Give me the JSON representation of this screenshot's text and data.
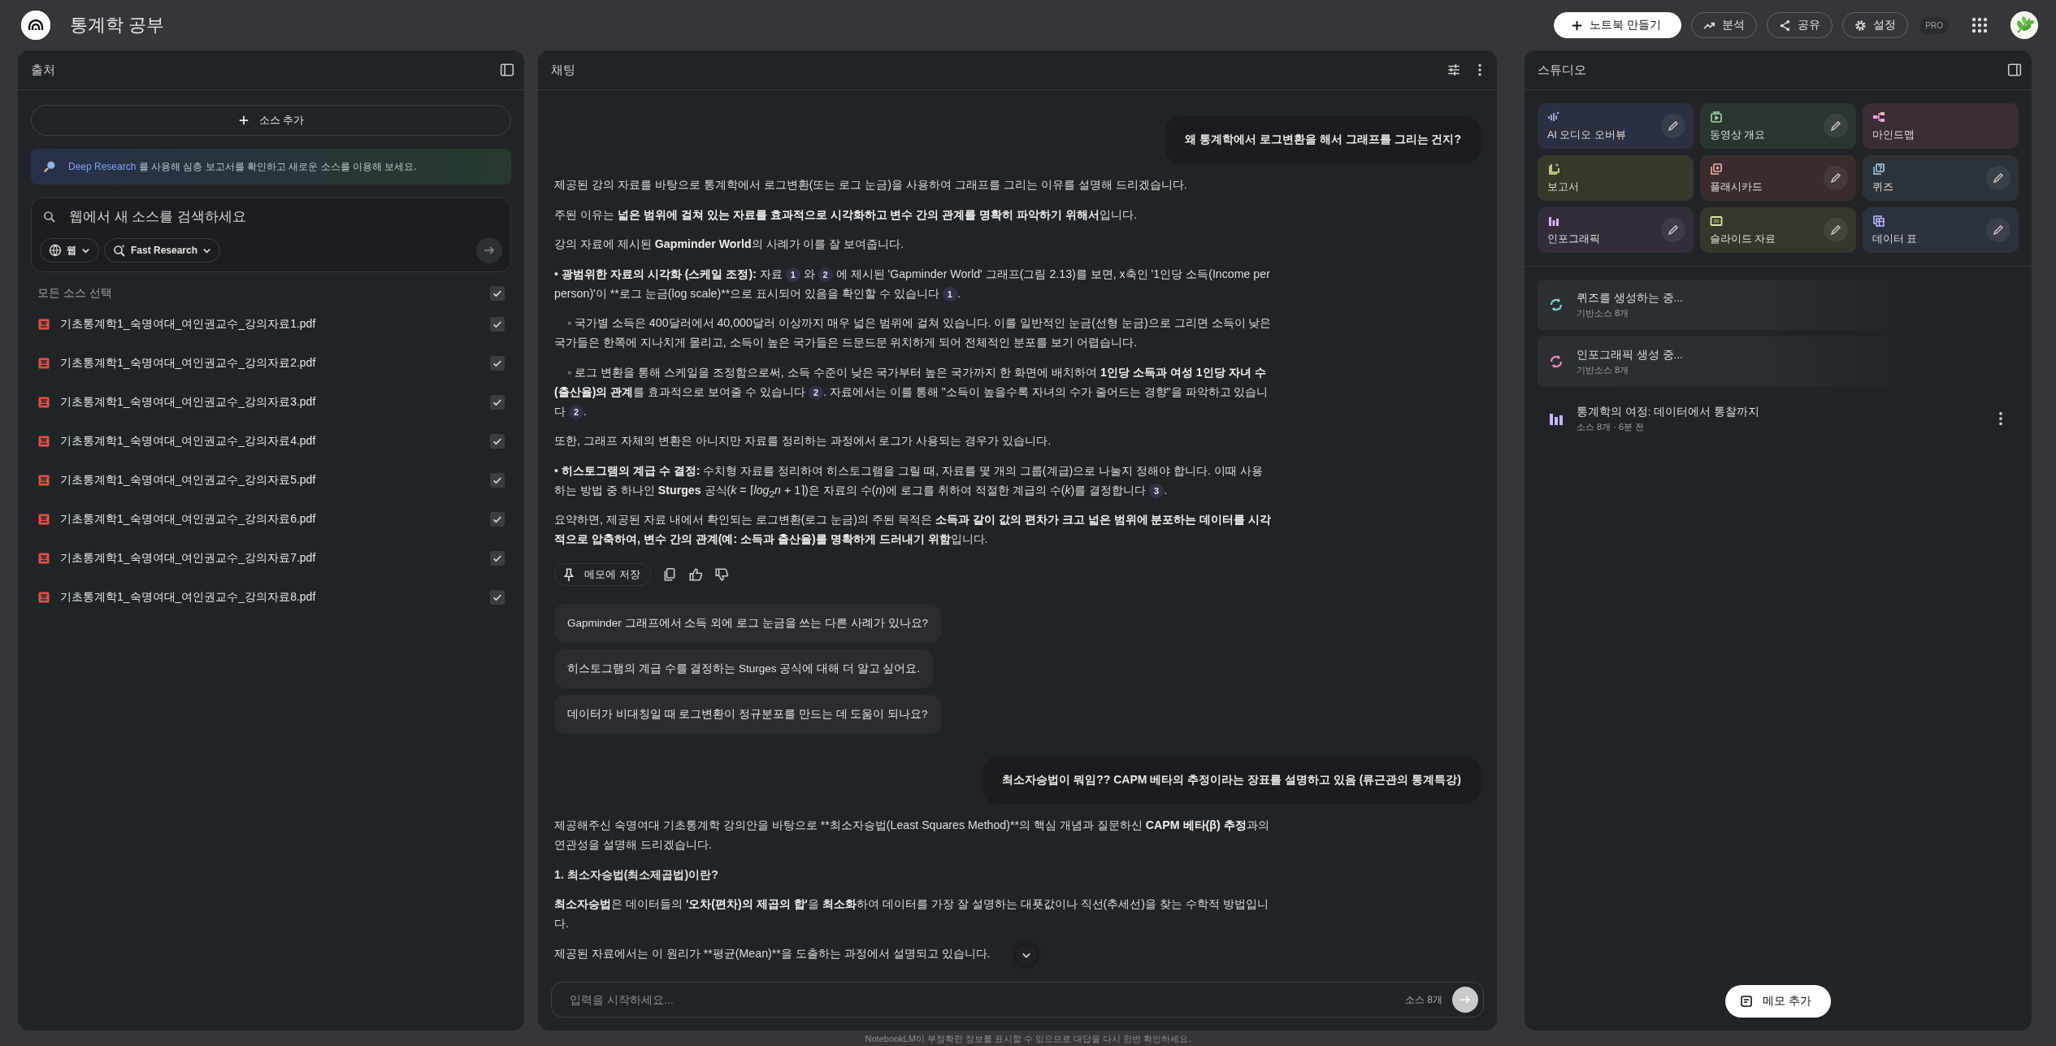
{
  "app": {
    "title": "통계학 공부"
  },
  "header_actions": [
    {
      "kind": "create",
      "label": "노트북 만들기"
    },
    {
      "kind": "analytics",
      "label": "분석"
    },
    {
      "kind": "share",
      "label": "공유"
    },
    {
      "kind": "settings",
      "label": "설정"
    }
  ],
  "plan_badge": "PRO",
  "sources": {
    "title": "출처",
    "add_button": "소스 추가",
    "banner": {
      "link": "Deep Research",
      "text": " 를 사용해 심층 보고서를 확인하고 새로운 소스를 이용해 보세요."
    },
    "search": {
      "placeholder": "웹에서 새 소스를 검색하세요",
      "source_chip": "웹",
      "mode_chip": "Fast Research"
    },
    "select_all": {
      "label": "모든 소스 선택",
      "checked": true
    },
    "items": [
      {
        "name": "기초통계학1_숙명여대_여인권교수_강의자료1.pdf",
        "checked": true
      },
      {
        "name": "기초통계학1_숙명여대_여인권교수_강의자료2.pdf",
        "checked": true
      },
      {
        "name": "기초통계학1_숙명여대_여인권교수_강의자료3.pdf",
        "checked": true
      },
      {
        "name": "기초통계학1_숙명여대_여인권교수_강의자료4.pdf",
        "checked": true
      },
      {
        "name": "기초통계학1_숙명여대_여인권교수_강의자료5.pdf",
        "checked": true
      },
      {
        "name": "기초통계학1_숙명여대_여인권교수_강의자료6.pdf",
        "checked": true
      },
      {
        "name": "기초통계학1_숙명여대_여인권교수_강의자료7.pdf",
        "checked": true
      },
      {
        "name": "기초통계학1_숙명여대_여인권교수_강의자료8.pdf",
        "checked": true
      }
    ]
  },
  "chat": {
    "title": "채팅",
    "messages": [
      {
        "kind": "user",
        "text": "왜 통계학에서 로그변환을 해서 그래프를 그리는 건지?"
      },
      {
        "kind": "answer",
        "save_label": "메모에 저장",
        "blocks": [
          {
            "kind": "p",
            "parts": [
              {
                "md": "제공된 강의 자료를 바탕으로 통계학에서 로그변환(또는 로그 눈금)을 사용하여 그래프를 그리는 이유를 설명해 드리겠습니다."
              }
            ]
          },
          {
            "kind": "p",
            "parts": [
              {
                "md": "주된 이유는 **넓은 범위에 걸쳐 있는 자료를 효과적으로 시각화하고 변수 간의 관계를 명확히 파악하기 위해서**입니다."
              }
            ]
          },
          {
            "kind": "p",
            "parts": [
              {
                "md": "강의 자료에 제시된 **Gapminder World**의 사례가 이를 잘 보여줍니다."
              }
            ]
          },
          {
            "kind": "p",
            "parts": [
              {
                "md": "• **광범위한 자료의 시각화 (스케일 조정):** 자료 "
              },
              {
                "cite": "1"
              },
              {
                "md": " 와 "
              },
              {
                "cite": "2"
              },
              {
                "md": " 에 제시된 'Gapminder World' 그래프(그림 2.13)를 보면, x축인 '1인당 소득(Income per person)'이 "
              },
              {
                "text": "**로그 눈금(log scale)**"
              },
              {
                "md": "으로 표시되어 있음을 확인할 수 있습니다 "
              },
              {
                "cite": "1"
              },
              {
                "md": "."
              }
            ]
          },
          {
            "kind": "sub",
            "parts": [
              {
                "md": "◦ 국가별 소득은 400달러에서 40,000달러 이상까지 매우 넓은 범위에 걸쳐 있습니다. 이를 일반적인 눈금(선형 눈금)으로 그리면 소득이 낮은 국가들은 한쪽에 지나치게 몰리고, 소득이 높은 국가들은 드문드문 위치하게 되어 전체적인 분포를 보기 어렵습니다."
              }
            ]
          },
          {
            "kind": "sub",
            "parts": [
              {
                "md": "◦ 로그 변환을 통해 스케일을 조정함으로써, 소득 수준이 낮은 국가부터 높은 국가까지 한 화면에 배치하여 **1인당 소득과 여성 1인당 자녀 수(출산율)의 관계**를 효과적으로 보여줄 수 있습니다 "
              },
              {
                "cite": "2"
              },
              {
                "md": ". 자료에서는 이를 통해 \"소득이 높을수록 자녀의 수가 줄어드는 경향\"을 파악하고 있습니다 "
              },
              {
                "cite": "2"
              },
              {
                "md": "."
              }
            ]
          },
          {
            "kind": "p",
            "parts": [
              {
                "md": "또한, 그래프 자체의 변환은 아니지만 자료를 정리하는 과정에서 로그가 사용되는 경우가 있습니다."
              }
            ]
          },
          {
            "kind": "p",
            "parts": [
              {
                "md": "• **히스토그램의 계급 수 결정:** 수치형 자료를 정리하여 히스토그램을 그릴 때, 자료를 몇 개의 그룹(계급)으로 나눌지 정해야 합니다. 이때 사용하는 방법 중 하나인 **Sturges** 공식(*k* = ⌈*log*$_{2}$*n* + 1⌉)은 자료의 수(*n*)에 로그를 취하여 적절한 계급의 수(*k*)를 결정합니다 "
              },
              {
                "cite": "3"
              },
              {
                "md": "."
              }
            ]
          },
          {
            "kind": "p",
            "parts": [
              {
                "md": "요약하면, 제공된 자료 내에서 확인되는 로그변환(로그 눈금)의 주된 목적은 **소득과 같이 값의 편차가 크고 넓은 범위에 분포하는 데이터를 시각적으로 압축하여, 변수 간의 관계(예: 소득과 출산율)를 명확하게 드러내기 위함**입니다."
              }
            ]
          }
        ]
      },
      {
        "kind": "suggestions",
        "items": [
          "Gapminder 그래프에서 소득 외에 로그 눈금을 쓰는 다른 사례가 있나요?",
          "히스토그램의 계급 수를 결정하는 Sturges 공식에 대해 더 알고 싶어요.",
          "데이터가 비대칭일 때 로그변환이 정규분포를 만드는 데 도움이 되나요?"
        ]
      },
      {
        "kind": "user",
        "text": "최소자승법이 뭐임?? CAPM 베타의 추정이라는 장표를 설명하고 있음 (류근관의 통계특강)"
      },
      {
        "kind": "answer",
        "blocks": [
          {
            "kind": "p",
            "parts": [
              {
                "md": "제공해주신 숙명여대 기초통계학 강의안을 바탕으로 "
              },
              {
                "text": "**최소자승법(Least Squares Method)**"
              },
              {
                "md": "의 핵심 개념과 질문하신 **CAPM 베타(β) 추정**과의 연관성을 설명해 드리겠습니다."
              }
            ]
          },
          {
            "kind": "heading",
            "parts": [
              {
                "md": "1. 최소자승법(최소제곱법)이란?"
              }
            ]
          },
          {
            "kind": "p",
            "parts": [
              {
                "md": "**최소자승법**은 데이터들의 **'오차(편차)의 제곱의 합'**을 **최소화**하여 데이터를 가장 잘 설명하는 대푯값이나 직선(추세선)을 찾는 수학적 방법입니다."
              }
            ]
          },
          {
            "kind": "p",
            "parts": [
              {
                "md": "제공된 자료에서는 이 원리가 "
              },
              {
                "text": "**평균(Mean)**"
              },
              {
                "md": "을 도출하는 과정에서 설명되고 있습니다."
              }
            ]
          }
        ]
      }
    ],
    "input": {
      "placeholder": "입력을 시작하세요...",
      "source_count": "소스 8개"
    },
    "disclaimer": "NotebookLM이 부정확한 정보를 표시할 수 있으므로 대답을 다시 한번 확인하세요."
  },
  "studio": {
    "title": "스튜디오",
    "tools": [
      {
        "kind": "audio",
        "label": "AI 오디오 오버뷰",
        "color": "#2b3040",
        "editable": true
      },
      {
        "kind": "video",
        "label": "동영상 개요",
        "color": "#2b3530",
        "editable": true
      },
      {
        "kind": "mindmap",
        "label": "마인드맵",
        "color": "#3a2d36",
        "editable": false
      },
      {
        "kind": "report",
        "label": "보고서",
        "color": "#36382a",
        "editable": false
      },
      {
        "kind": "flashcards",
        "label": "플래시카드",
        "color": "#3a2c2c",
        "editable": true
      },
      {
        "kind": "quiz",
        "label": "퀴즈",
        "color": "#2c3338",
        "editable": true
      },
      {
        "kind": "infographic",
        "label": "인포그래픽",
        "color": "#342c38",
        "editable": true
      },
      {
        "kind": "slides",
        "label": "슬라이드 자료",
        "color": "#34372b",
        "editable": true
      },
      {
        "kind": "table",
        "label": "데이터 표",
        "color": "#2c3140",
        "editable": true
      }
    ],
    "outputs": [
      {
        "kind": "pending",
        "title": "퀴즈를 생성하는 중...",
        "meta": "기반소스 8개",
        "color": "#7fd1c7"
      },
      {
        "kind": "pending",
        "title": "인포그래픽 생성 중...",
        "meta": "기반소스 8개",
        "color": "#e58fb8"
      },
      {
        "kind": "done",
        "title": "통계학의 여정: 데이터에서 통찰까지",
        "meta": "소스 8개 · 6분 전",
        "color": "#c8b6ff"
      }
    ],
    "add_note": "메모 추가"
  }
}
